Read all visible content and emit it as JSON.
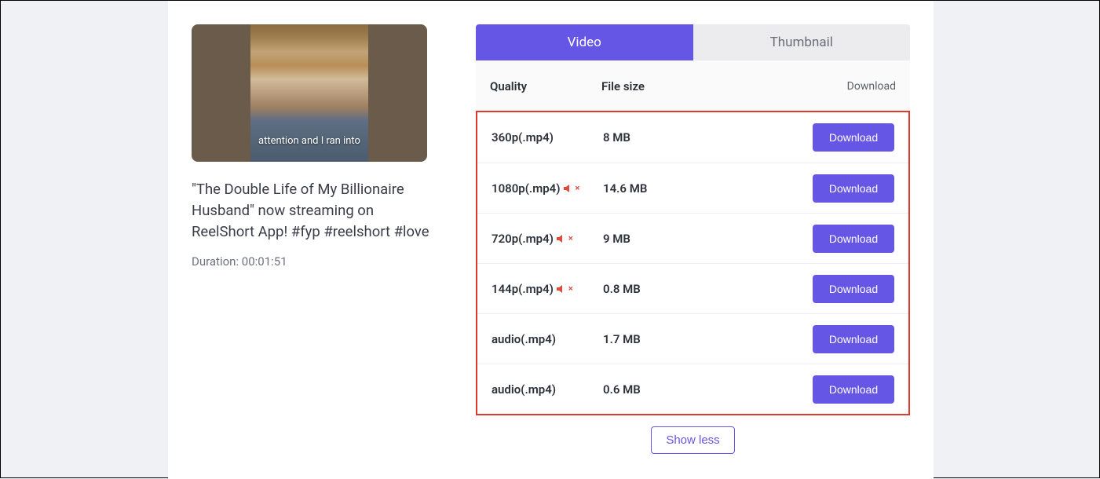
{
  "video": {
    "overlayCaption": "attention and I ran into",
    "title": "\"The Double Life of My Billionaire Husband\" now streaming on ReelShort App! #fyp #reelshort #love",
    "durationLabel": "Duration: 00:01:51"
  },
  "tabs": {
    "video": "Video",
    "thumbnail": "Thumbnail"
  },
  "table": {
    "headers": {
      "quality": "Quality",
      "filesize": "File size",
      "download": "Download"
    },
    "rows": [
      {
        "quality": "360p(.mp4)",
        "muted": false,
        "size": "8 MB",
        "button": "Download"
      },
      {
        "quality": "1080p(.mp4)",
        "muted": true,
        "size": "14.6 MB",
        "button": "Download"
      },
      {
        "quality": "720p(.mp4)",
        "muted": true,
        "size": "9 MB",
        "button": "Download"
      },
      {
        "quality": "144p(.mp4)",
        "muted": true,
        "size": "0.8 MB",
        "button": "Download"
      },
      {
        "quality": "audio(.mp4)",
        "muted": false,
        "size": "1.7 MB",
        "button": "Download"
      },
      {
        "quality": "audio(.mp4)",
        "muted": false,
        "size": "0.6 MB",
        "button": "Download"
      }
    ]
  },
  "showLess": "Show less"
}
